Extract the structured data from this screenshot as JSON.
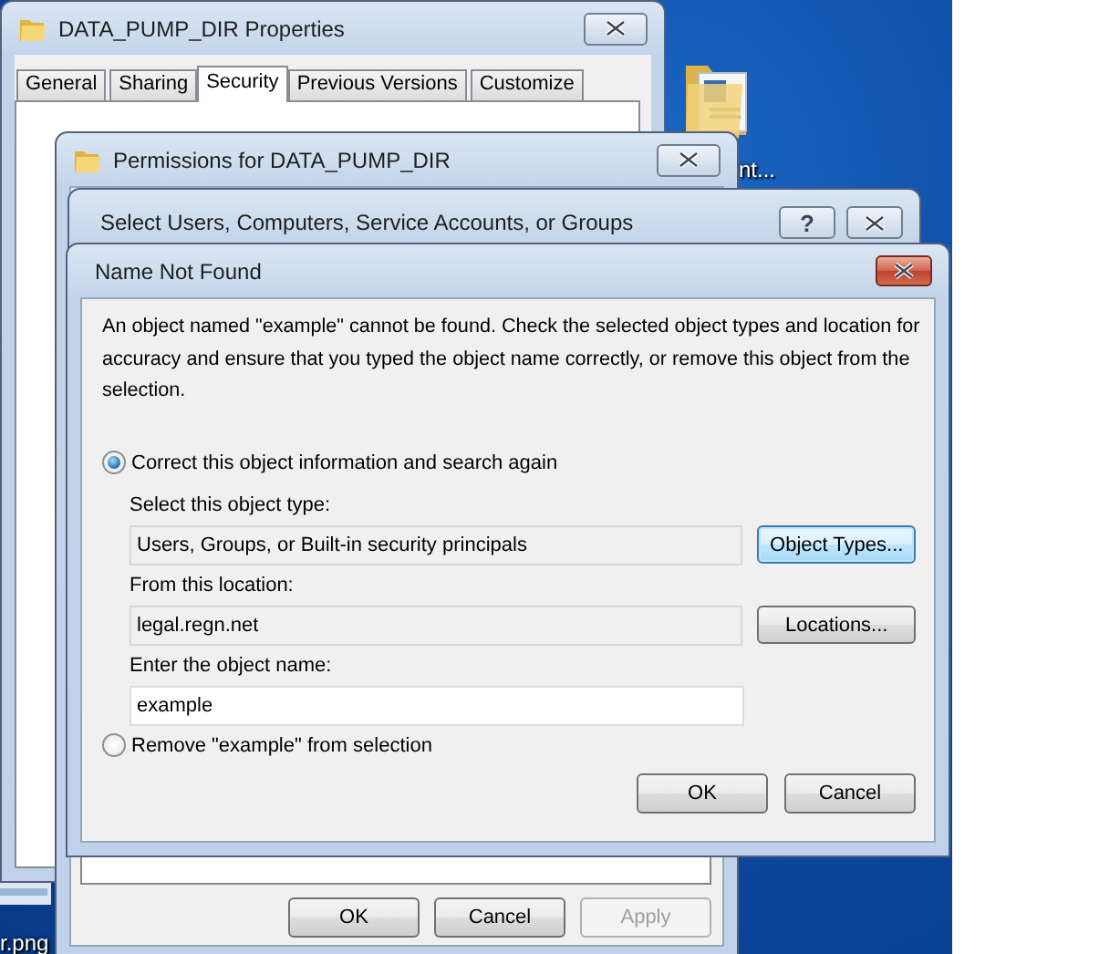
{
  "desktop": {
    "icons": [
      {
        "kind": "folder",
        "label": "nt..."
      },
      {
        "kind": "image",
        "label": "r.png"
      }
    ]
  },
  "properties_window": {
    "title": "DATA_PUMP_DIR Properties",
    "tabs": [
      {
        "label": "General",
        "selected": false
      },
      {
        "label": "Sharing",
        "selected": false
      },
      {
        "label": "Security",
        "selected": true
      },
      {
        "label": "Previous Versions",
        "selected": false
      },
      {
        "label": "Customize",
        "selected": false
      }
    ]
  },
  "permissions_window": {
    "title": "Permissions for DATA_PUMP_DIR",
    "buttons": [
      {
        "label": "OK",
        "disabled": false
      },
      {
        "label": "Cancel",
        "disabled": false
      },
      {
        "label": "Apply",
        "disabled": true
      }
    ]
  },
  "select_window": {
    "title": "Select Users, Computers, Service Accounts, or Groups",
    "help_button": "?"
  },
  "name_not_found_dialog": {
    "title": "Name Not Found",
    "message": "An object named \"example\" cannot be found. Check the selected object types and location for accuracy and ensure that you typed the object name correctly, or remove this object from the selection.",
    "options": [
      {
        "label": "Correct this object information and search again",
        "selected": true,
        "fields": [
          {
            "label": "Select this object type:",
            "value": "Users, Groups, or Built-in security principals",
            "editable": false,
            "button": {
              "label": "Object Types...",
              "focused": true
            }
          },
          {
            "label": "From this location:",
            "value": "legal.regn.net",
            "editable": false,
            "button": {
              "label": "Locations...",
              "focused": false
            }
          },
          {
            "label": "Enter the object name:",
            "value": "example",
            "editable": true
          }
        ]
      },
      {
        "label": "Remove \"example\" from selection",
        "selected": false
      }
    ],
    "buttons": [
      "OK",
      "Cancel"
    ]
  }
}
